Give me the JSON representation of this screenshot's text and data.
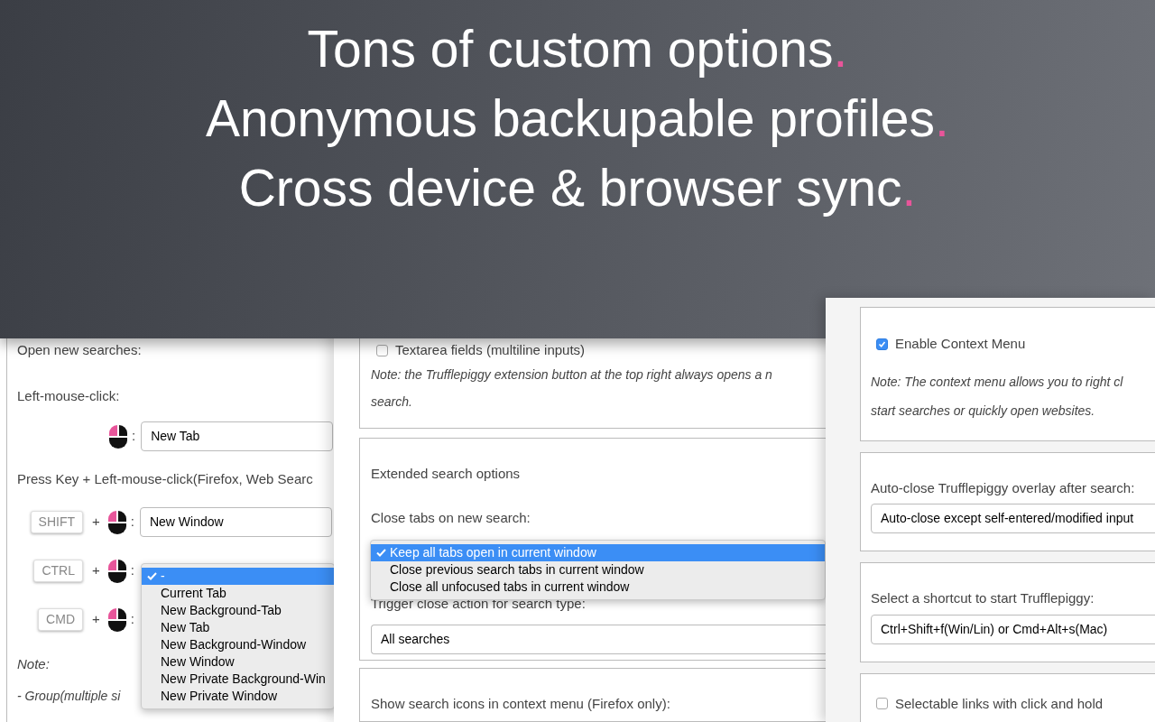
{
  "headline": {
    "lines": [
      {
        "text": "Tons of custom options",
        "dot": "."
      },
      {
        "text": "Anonymous backupable profiles",
        "dot": "."
      },
      {
        "text": "Cross device & browser sync",
        "dot": "."
      }
    ]
  },
  "panel_left": {
    "heading": "Open new searches:",
    "left_click_label": "Left-mouse-click:",
    "left_click_colon": ":",
    "left_click_value": "New Tab",
    "key_click_label": "Press Key + Left-mouse-click(Firefox, Web Searc",
    "shortcuts": [
      {
        "key": "SHIFT",
        "plus": "+",
        "colon": ":",
        "value": "New Window"
      },
      {
        "key": "CTRL",
        "plus": "+",
        "colon": ":"
      },
      {
        "key": "CMD",
        "plus": "+",
        "colon": ":"
      }
    ],
    "note_label": "Note:",
    "note_text": "- Group(multiple si",
    "dropdown": {
      "options": [
        {
          "label": "-",
          "selected": true
        },
        {
          "label": "Current Tab",
          "selected": false
        },
        {
          "label": "New Background-Tab",
          "selected": false
        },
        {
          "label": "New Tab",
          "selected": false
        },
        {
          "label": "New Background-Window",
          "selected": false
        },
        {
          "label": "New Window",
          "selected": false
        },
        {
          "label": "New Private Background-Win",
          "selected": false
        },
        {
          "label": "New Private Window",
          "selected": false
        }
      ]
    }
  },
  "panel_middle": {
    "textarea_option": {
      "label": "Textarea fields (multiline inputs)",
      "checked": false
    },
    "note_lines": [
      "Note: the Trufflepiggy extension button at the top right always opens a n",
      "search."
    ],
    "section_title": "Extended search options",
    "close_tabs_label": "Close tabs on new search:",
    "close_tabs_dropdown": {
      "options": [
        {
          "label": "Keep all tabs open in current window",
          "selected": true
        },
        {
          "label": "Close previous search tabs in current window",
          "selected": false
        },
        {
          "label": "Close all unfocused tabs in current window",
          "selected": false
        }
      ]
    },
    "trigger_label": "Trigger close action for search type:",
    "trigger_value": "All searches",
    "context_icons_label": "Show search icons in context menu (Firefox only):"
  },
  "panel_right": {
    "context_menu_option": {
      "label": "Enable Context Menu",
      "checked": true
    },
    "note_lines": [
      "Note: The context menu allows you to right cl",
      "start searches or quickly open websites."
    ],
    "auto_close_label": "Auto-close Trufflepiggy overlay after search:",
    "auto_close_value": "Auto-close except self-entered/modified input",
    "shortcut_label": "Select a shortcut to start Trufflepiggy:",
    "shortcut_value": "Ctrl+Shift+f(Win/Lin) or Cmd+Alt+s(Mac)",
    "selectable_links_option": {
      "label": "Selectable links with click and hold",
      "checked": false
    }
  }
}
